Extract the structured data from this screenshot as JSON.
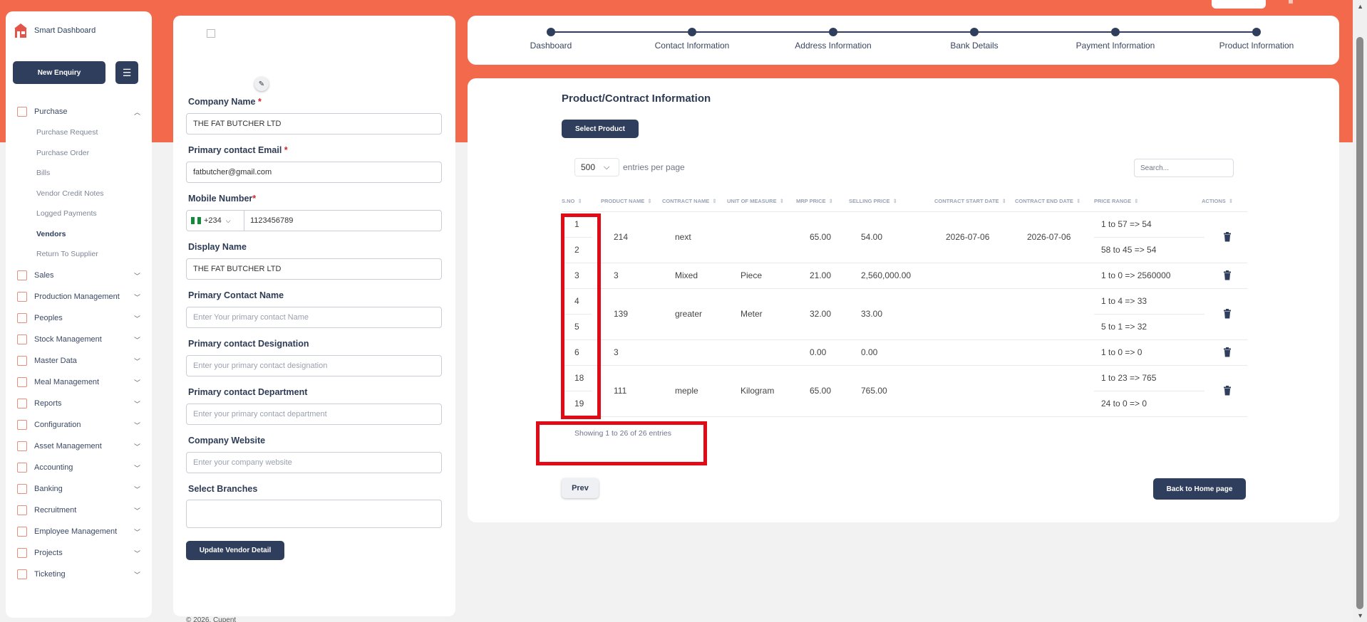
{
  "brand": {
    "name": "Smart Dashboard"
  },
  "sidebar": {
    "new_enquiry_label": "New Enquiry",
    "items": [
      {
        "label": "Purchase",
        "expanded": true
      },
      {
        "label": "Sales"
      },
      {
        "label": "Production Management"
      },
      {
        "label": "Peoples"
      },
      {
        "label": "Stock Management"
      },
      {
        "label": "Master Data"
      },
      {
        "label": "Meal Management"
      },
      {
        "label": "Reports"
      },
      {
        "label": "Configuration"
      },
      {
        "label": "Asset Management"
      },
      {
        "label": "Accounting"
      },
      {
        "label": "Banking"
      },
      {
        "label": "Recruitment"
      },
      {
        "label": "Employee Management"
      },
      {
        "label": "Projects"
      },
      {
        "label": "Ticketing"
      }
    ],
    "purchase_sub": [
      "Purchase Request",
      "Purchase Order",
      "Bills",
      "Vendor Credit Notes",
      "Logged Payments",
      "Vendors",
      "Return To Supplier"
    ],
    "active_sub": "Vendors"
  },
  "form": {
    "company_name_label": "Company Name",
    "company_name_value": "THE FAT BUTCHER LTD",
    "email_label": "Primary contact Email",
    "email_value": "fatbutcher@gmail.com",
    "mobile_label": "Mobile Number",
    "country_code": "+234",
    "mobile_value": "1123456789",
    "display_name_label": "Display Name",
    "display_name_value": "THE FAT BUTCHER LTD",
    "contact_name_label": "Primary Contact Name",
    "contact_name_placeholder": "Enter Your primary contact Name",
    "designation_label": "Primary contact Designation",
    "designation_placeholder": "Enter your primary contact designation",
    "department_label": "Primary contact Department",
    "department_placeholder": "Enter your primary contact department",
    "website_label": "Company Website",
    "website_placeholder": "Enter your company website",
    "branches_label": "Select Branches",
    "update_label": "Update Vendor Detail",
    "required_mark": "*"
  },
  "footer": {
    "text": "© 2026. Cupent"
  },
  "steps": [
    "Dashboard",
    "Contact Information",
    "Address Information",
    "Bank Details",
    "Payment Information",
    "Product Information"
  ],
  "products": {
    "title": "Product/Contract Information",
    "select_label": "Select Product",
    "entries_value": "500",
    "entries_text": "entries per page",
    "search_placeholder": "Search...",
    "columns": [
      "S.NO",
      "PRODUCT NAME",
      "CONTRACT NAME",
      "UNIT OF MEASURE",
      "MRP PRICE",
      "SELLING PRICE",
      "CONTRACT START DATE",
      "CONTRACT END DATE",
      "PRICE RANGE",
      "ACTIONS"
    ],
    "sno": [
      "1",
      "2",
      "3",
      "4",
      "5",
      "6",
      "18",
      "19"
    ],
    "groups": [
      {
        "product": "214",
        "contract": "next",
        "unit": "",
        "mrp": "65.00",
        "selling": "54.00",
        "start": "2026-07-06",
        "end": "2026-07-06",
        "ranges": [
          "1 to 57 => 54",
          "58 to 45 => 54"
        ]
      },
      {
        "product": "3",
        "contract": "Mixed",
        "unit": "Piece",
        "mrp": "21.00",
        "selling": "2,560,000.00",
        "start": "",
        "end": "",
        "ranges": [
          "1 to 0 => 2560000"
        ]
      },
      {
        "product": "139",
        "contract": "greater",
        "unit": "Meter",
        "mrp": "32.00",
        "selling": "33.00",
        "start": "",
        "end": "",
        "ranges": [
          "1 to 4 => 33",
          "5 to 1 => 32"
        ]
      },
      {
        "product": "3",
        "contract": "",
        "unit": "",
        "mrp": "0.00",
        "selling": "0.00",
        "start": "",
        "end": "",
        "ranges": [
          "1 to 0 => 0"
        ]
      },
      {
        "product": "111",
        "contract": "meple",
        "unit": "Kilogram",
        "mrp": "65.00",
        "selling": "765.00",
        "start": "",
        "end": "",
        "ranges": [
          "1 to 23 => 765",
          "24 to 0 => 0"
        ]
      }
    ],
    "showing": "Showing 1 to 26 of 26 entries",
    "prev_label": "Prev",
    "back_label": "Back to Home page"
  },
  "colors": {
    "accent": "#f26a4b",
    "primary": "#2f3e5c",
    "highlight": "#e10b17"
  }
}
